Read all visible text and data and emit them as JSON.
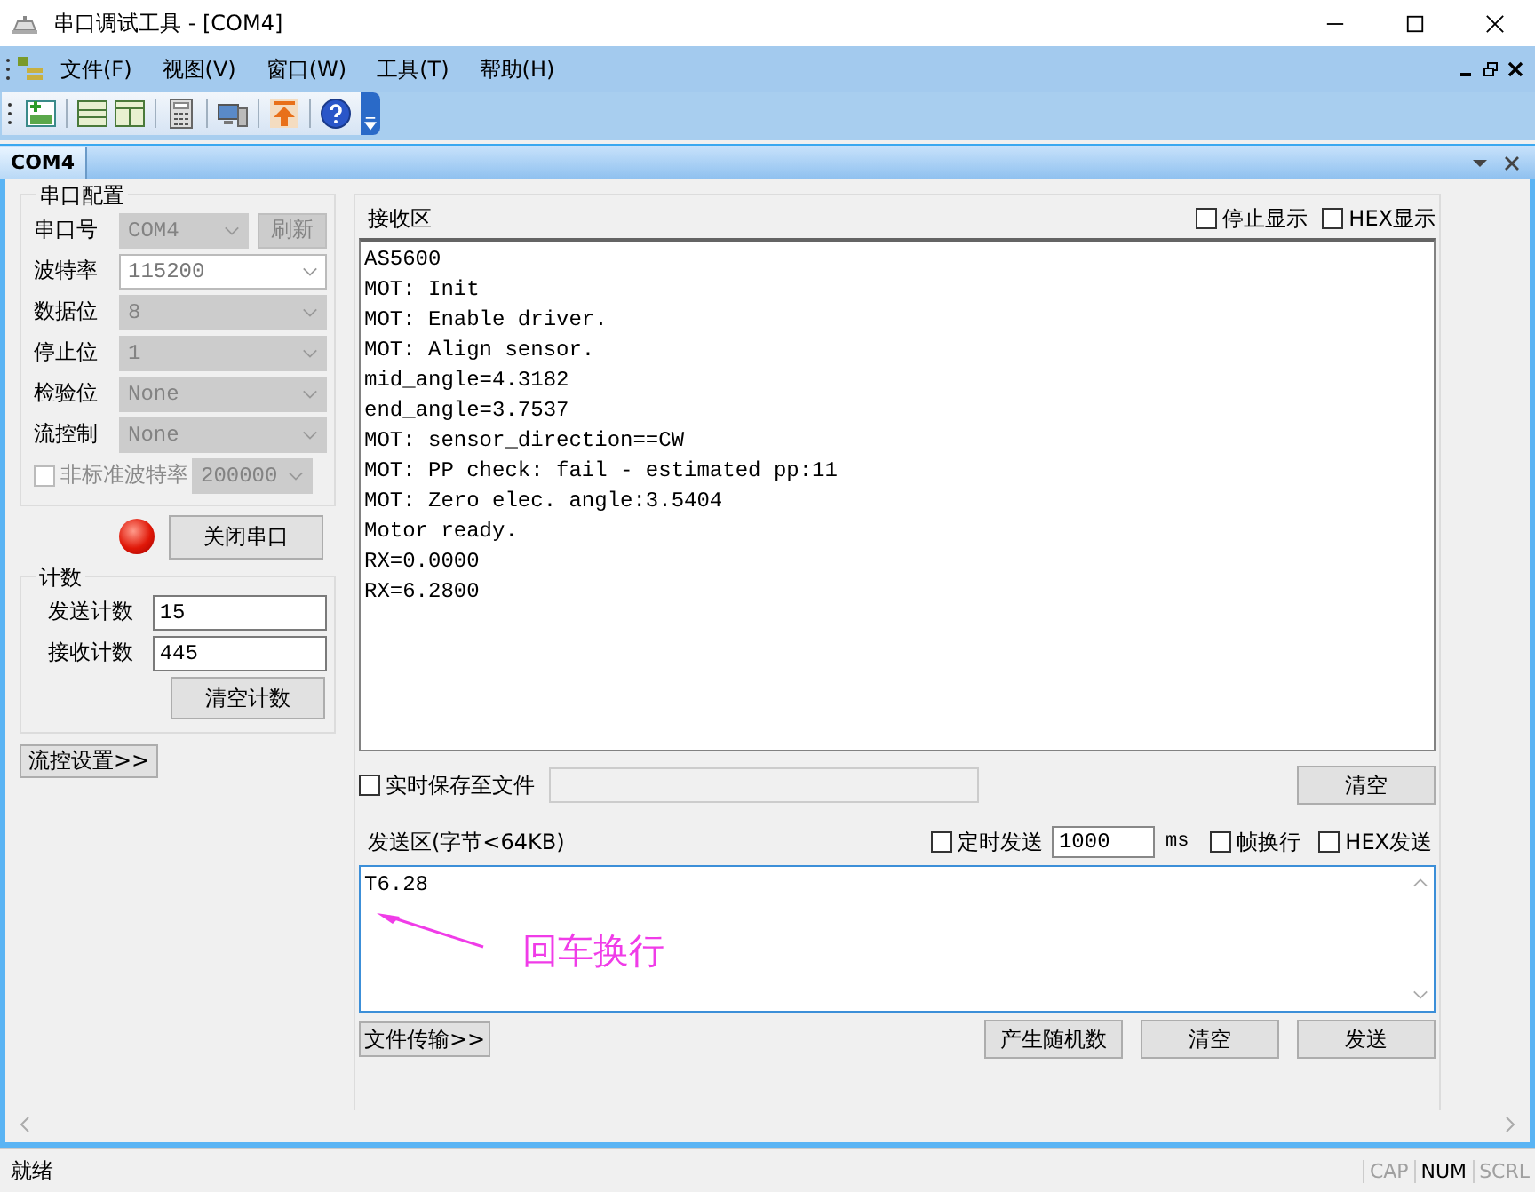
{
  "window": {
    "title": "串口调试工具 - [COM4]"
  },
  "menu": [
    "文件(F)",
    "视图(V)",
    "窗口(W)",
    "工具(T)",
    "帮助(H)"
  ],
  "document_tab": {
    "label": "COM4",
    "selected": true
  },
  "port_config": {
    "title": "串口配置",
    "fields": [
      {
        "label": "串口号",
        "value": "COM4",
        "disabled": true
      },
      {
        "label": "波特率",
        "value": "115200",
        "disabled": false
      },
      {
        "label": "数据位",
        "value": "8",
        "disabled": true
      },
      {
        "label": "停止位",
        "value": "1",
        "disabled": true
      },
      {
        "label": "检验位",
        "value": "None",
        "disabled": true
      },
      {
        "label": "流控制",
        "value": "None",
        "disabled": true
      }
    ],
    "refresh_button": {
      "label": "刷新",
      "disabled": true
    },
    "custom_baud": {
      "label": "非标准波特率",
      "checked": false,
      "disabled": true,
      "value": "200000"
    }
  },
  "port_indicator": {
    "on": true
  },
  "close_port_button": "关闭串口",
  "counters": {
    "title": "计数",
    "rows": [
      {
        "label": "发送计数",
        "value": "15"
      },
      {
        "label": "接收计数",
        "value": "445"
      }
    ],
    "clear_button": "清空计数"
  },
  "flow_button": "流控设置>>",
  "receive": {
    "title": "接收区",
    "options": [
      {
        "label": "停止显示",
        "checked": false
      },
      {
        "label": "HEX显示",
        "checked": false
      }
    ],
    "lines": [
      "AS5600",
      "MOT: Init",
      "MOT: Enable driver.",
      "MOT: Align sensor.",
      "mid_angle=4.3182",
      "end_angle=3.7537",
      "MOT: sensor_direction==CW",
      "MOT: PP check: fail - estimated pp:11",
      "MOT: Zero elec. angle:3.5404",
      "Motor ready.",
      "RX=0.0000",
      "RX=6.2800"
    ]
  },
  "save": {
    "label": "实时保存至文件",
    "checked": false,
    "clear_button": "清空"
  },
  "send": {
    "title": "发送区(字节<64KB)",
    "timed": {
      "label": "定时发送",
      "checked": false,
      "interval": "1000",
      "unit": "ms"
    },
    "options": [
      {
        "label": "帧换行",
        "checked": false
      },
      {
        "label": "HEX发送",
        "checked": false
      }
    ],
    "text": "T6.28",
    "annotation": "回车换行",
    "file_button": "文件传输>>",
    "buttons": [
      "产生随机数",
      "清空",
      "发送"
    ]
  },
  "status_bar": {
    "text": "就绪",
    "indicators": [
      {
        "label": "CAP",
        "on": false
      },
      {
        "label": "NUM",
        "on": true
      },
      {
        "label": "SCRL",
        "on": false
      }
    ]
  }
}
